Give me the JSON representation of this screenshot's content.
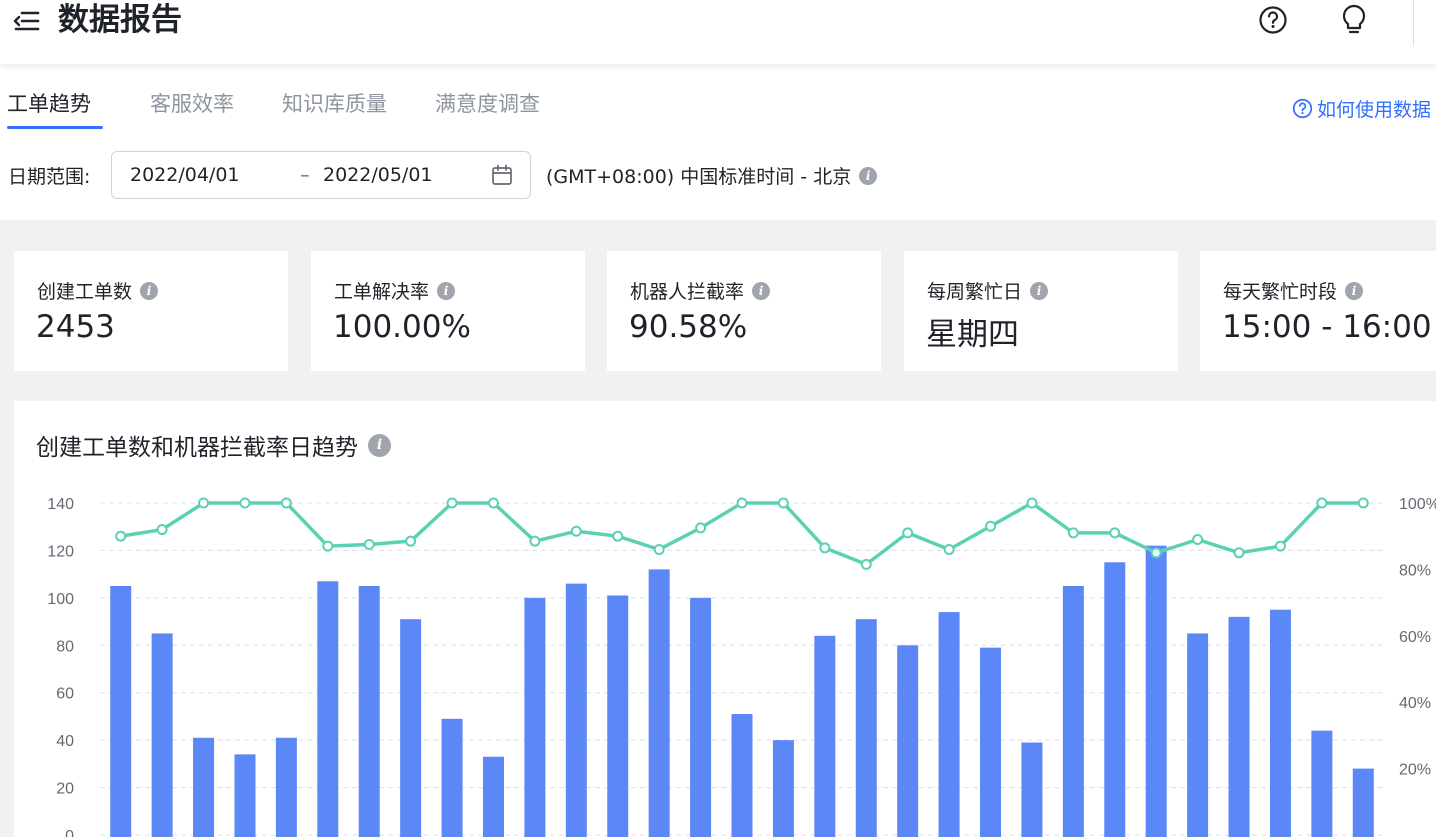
{
  "header": {
    "title": "数据报告",
    "menu_icon": "menu-collapse-icon",
    "help_icon": "help-circle-icon",
    "tips_icon": "lightbulb-icon"
  },
  "tabs": [
    {
      "label": "工单趋势",
      "active": true
    },
    {
      "label": "客服效率",
      "active": false
    },
    {
      "label": "知识库质量",
      "active": false
    },
    {
      "label": "满意度调查",
      "active": false
    }
  ],
  "help_link": "如何使用数据",
  "filters": {
    "date_label": "日期范围:",
    "start_date": "2022/04/01",
    "separator": "–",
    "end_date": "2022/05/01",
    "timezone": "(GMT+08:00) 中国标准时间 - 北京"
  },
  "metrics": [
    {
      "title": "创建工单数",
      "value": "2453"
    },
    {
      "title": "工单解决率",
      "value": "100.00%"
    },
    {
      "title": "机器人拦截率",
      "value": "90.58%"
    },
    {
      "title": "每周繁忙日",
      "value": "星期四"
    },
    {
      "title": "每天繁忙时段",
      "value": "15:00 - 16:00"
    }
  ],
  "chart": {
    "title": "创建工单数和机器拦截率日趋势"
  },
  "colors": {
    "accent": "#3370ff",
    "bar": "#5b87f7",
    "line": "#5bd1b4",
    "background": "#eff1f3"
  },
  "chart_data": {
    "type": "bar",
    "title": "创建工单数和机器拦截率日趋势",
    "y_left": {
      "ticks": [
        "0",
        "20",
        "40",
        "60",
        "80",
        "100",
        "120",
        "140"
      ],
      "range": [
        0,
        140
      ]
    },
    "y_right": {
      "ticks": [
        "20%",
        "40%",
        "60%",
        "80%",
        "100%"
      ],
      "range": [
        0,
        100
      ],
      "unit": "%"
    },
    "grid": true,
    "series": [
      {
        "kind": "bar",
        "axis": "left",
        "values": [
          105,
          85,
          41,
          34,
          41,
          107,
          105,
          91,
          49,
          33,
          100,
          106,
          101,
          112,
          100,
          51,
          40,
          84,
          91,
          80,
          94,
          79,
          39,
          105,
          115,
          122,
          85,
          92,
          95,
          44,
          28
        ]
      },
      {
        "kind": "line",
        "axis": "right",
        "values": [
          90,
          92,
          100,
          100,
          100,
          87,
          87.5,
          88.5,
          100,
          100,
          88.5,
          91.5,
          90,
          86,
          92.5,
          100,
          100,
          86.5,
          81.5,
          91,
          86,
          93,
          100,
          91,
          91,
          85,
          89,
          85,
          87,
          100,
          100
        ]
      }
    ]
  }
}
